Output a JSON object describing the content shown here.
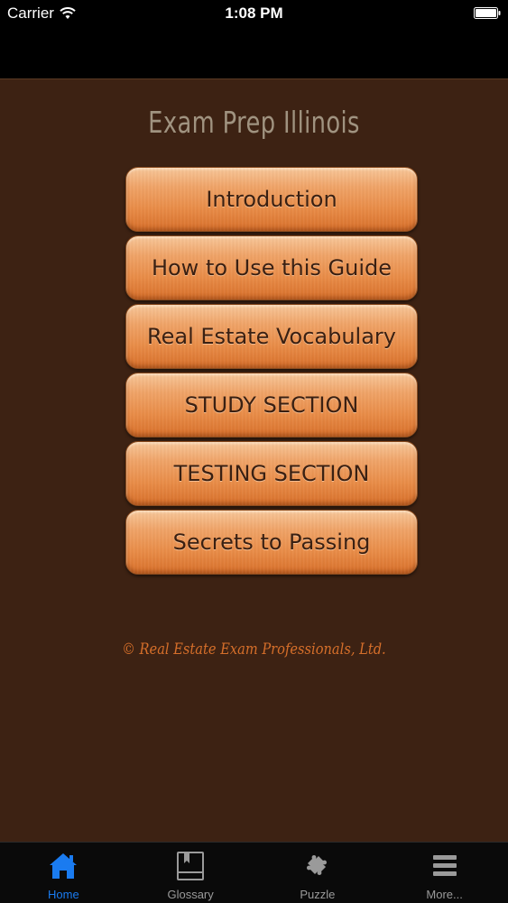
{
  "status_bar": {
    "carrier": "Carrier",
    "time": "1:08 PM",
    "wifi_icon": "wifi-icon",
    "battery_icon": "battery-icon"
  },
  "app": {
    "title": "Exam Prep Illinois",
    "copyright": "© Real Estate Exam Professionals, Ltd."
  },
  "menu": {
    "items": [
      {
        "label": "Introduction"
      },
      {
        "label": "How to Use this Guide"
      },
      {
        "label": "Real Estate Vocabulary"
      },
      {
        "label": "STUDY SECTION"
      },
      {
        "label": "TESTING SECTION"
      },
      {
        "label": "Secrets to Passing"
      }
    ]
  },
  "tab_bar": {
    "tabs": [
      {
        "label": "Home",
        "icon": "home-icon",
        "active": true
      },
      {
        "label": "Glossary",
        "icon": "book-icon",
        "active": false
      },
      {
        "label": "Puzzle",
        "icon": "puzzle-icon",
        "active": false
      },
      {
        "label": "More...",
        "icon": "menu-icon",
        "active": false
      }
    ]
  },
  "colors": {
    "background": "#3d2213",
    "button_orange": "#e98c47",
    "copyright_text": "#d66f2a",
    "title_text": "#a09380",
    "tab_active": "#1a7bf0",
    "tab_inactive": "#9a9a9a"
  }
}
